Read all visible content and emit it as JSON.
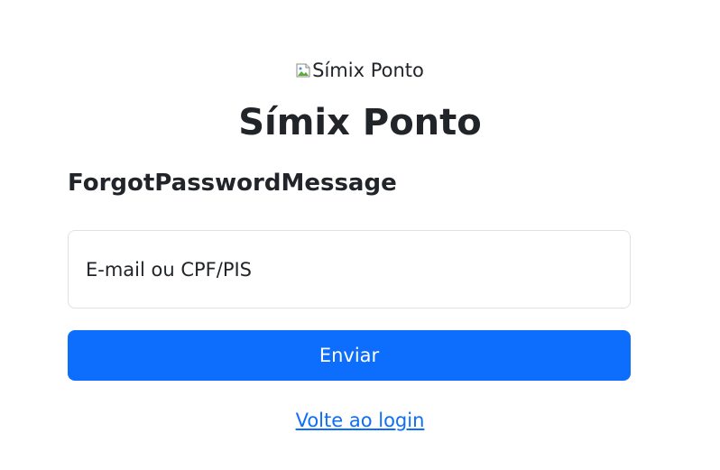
{
  "logo": {
    "alt_text": "Símix Ponto",
    "icon": "broken-image-icon"
  },
  "title": "Símix Ponto",
  "message": "ForgotPasswordMessage",
  "form": {
    "identifier_placeholder": "E-mail ou CPF/PIS",
    "identifier_value": "",
    "submit_label": "Enviar"
  },
  "back_link": {
    "label": "Volte ao login"
  },
  "colors": {
    "primary": "#0d6efd",
    "text": "#212529",
    "border": "#dee2e6",
    "background": "#ffffff"
  }
}
